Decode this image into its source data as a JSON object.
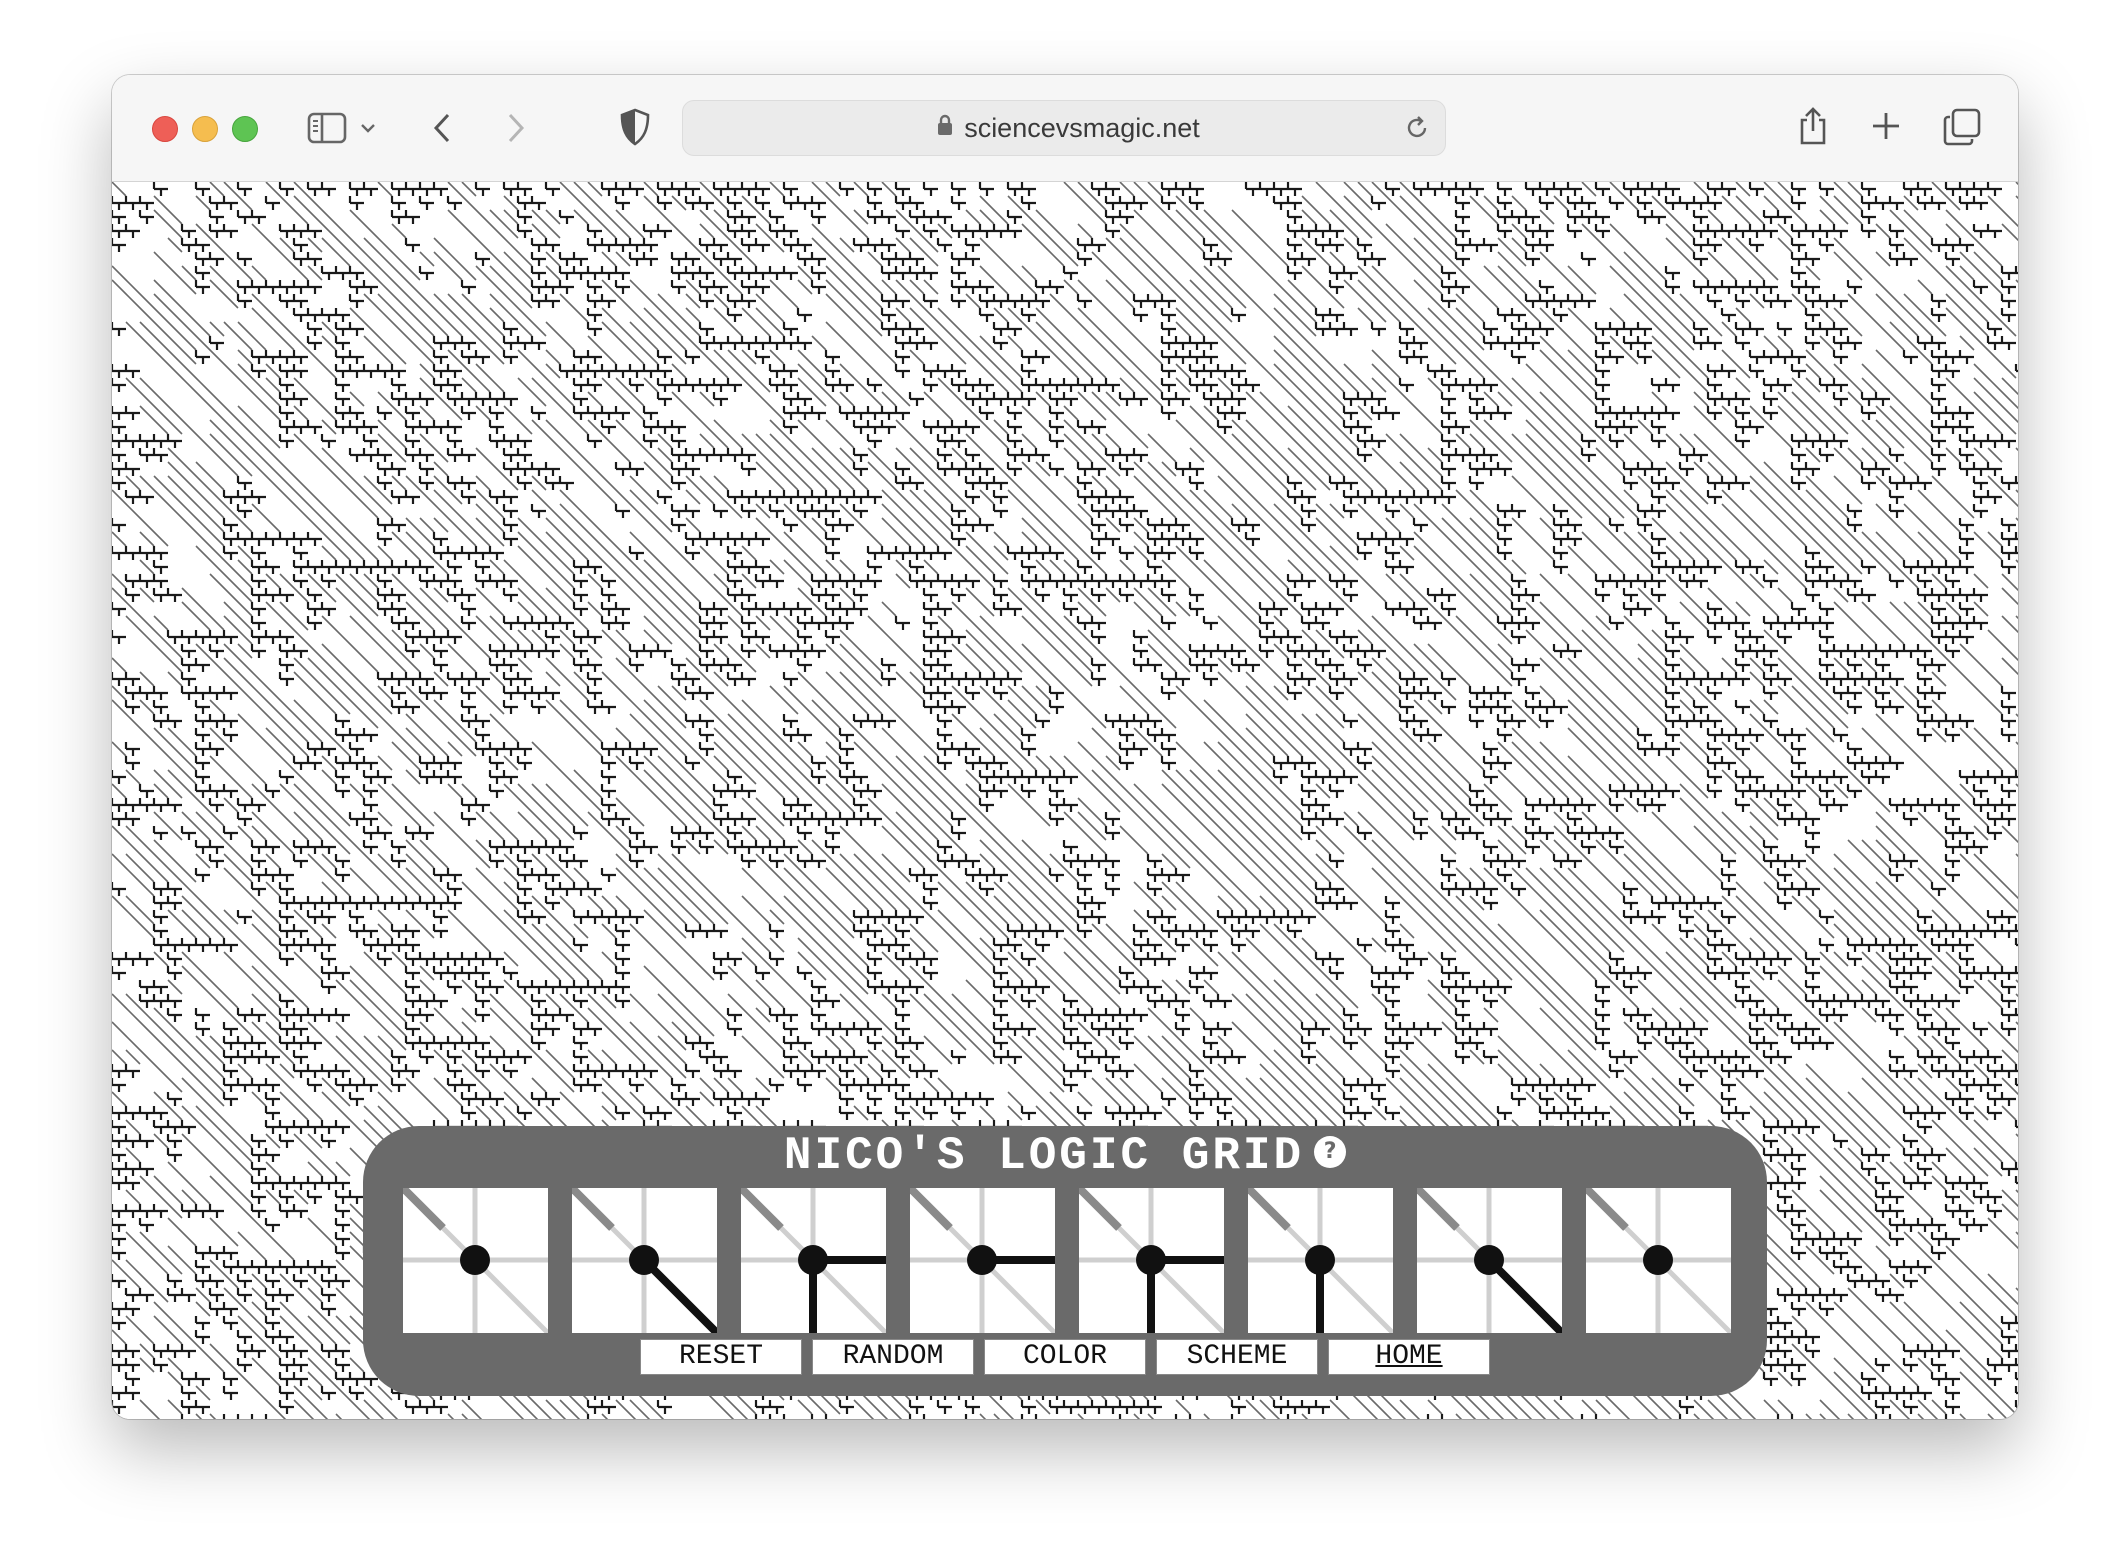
{
  "browser": {
    "url": "sciencevsmagic.net",
    "icons": [
      "sidebar-icon",
      "chevron-down-icon",
      "back-icon",
      "forward-icon",
      "shield-icon",
      "lock-icon",
      "reload-icon",
      "share-icon",
      "plus-icon",
      "tabs-icon"
    ]
  },
  "panel": {
    "title": "NICO'S LOGIC GRID",
    "help_label": "?",
    "rules": [
      {
        "diag": false,
        "right": false,
        "down": false
      },
      {
        "diag": true,
        "right": false,
        "down": false
      },
      {
        "diag": false,
        "right": true,
        "down": true
      },
      {
        "diag": false,
        "right": true,
        "down": false
      },
      {
        "diag": false,
        "right": true,
        "down": true
      },
      {
        "diag": false,
        "right": false,
        "down": true
      },
      {
        "diag": true,
        "right": false,
        "down": false
      },
      {
        "diag": false,
        "right": false,
        "down": false
      }
    ],
    "buttons": {
      "reset": "RESET",
      "random": "RANDOM",
      "color": "COLOR",
      "scheme": "SCHEME",
      "home": "HOME"
    }
  },
  "colors": {
    "panel_bg": "#6a6a6a",
    "line": "#111111",
    "faint_line": "#cfcfcf"
  }
}
